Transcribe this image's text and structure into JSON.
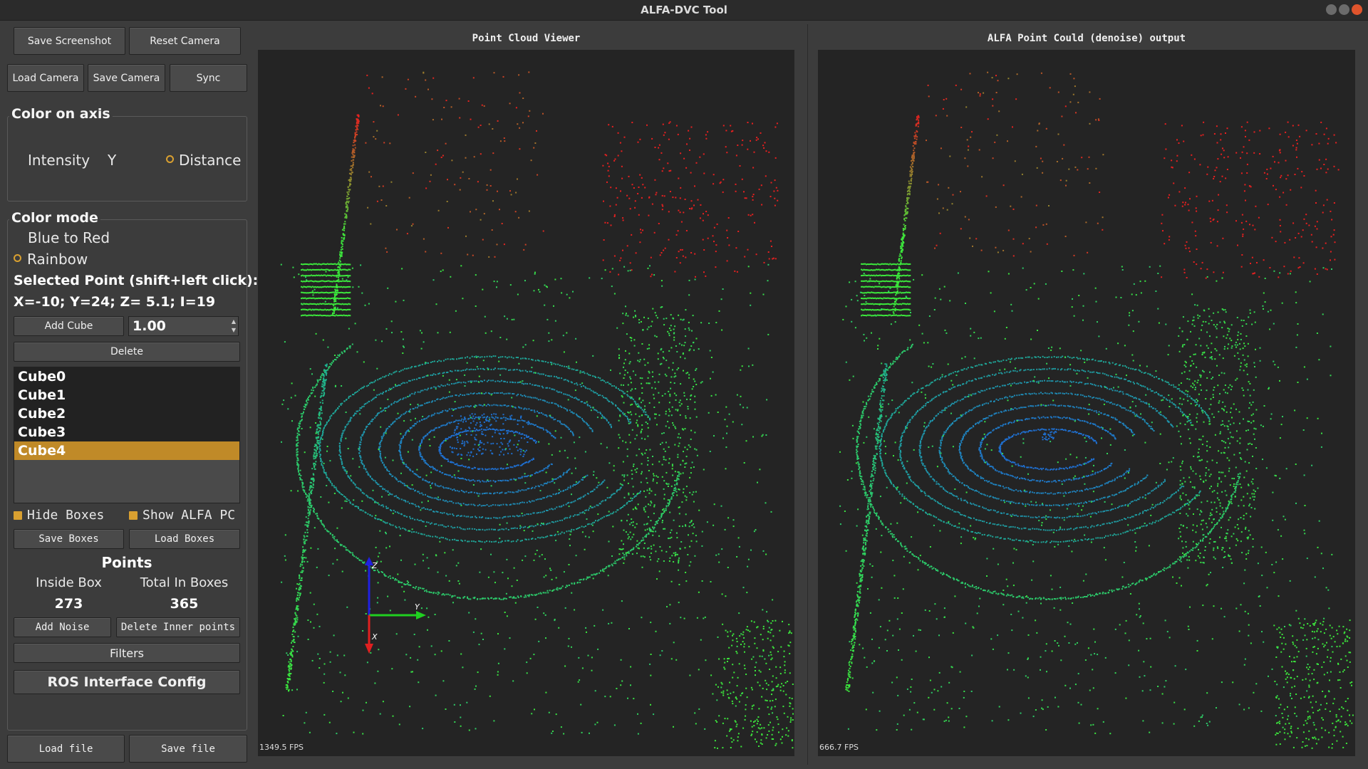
{
  "window": {
    "title": "ALFA-DVC Tool"
  },
  "camera_buttons": {
    "save_screenshot": "Save Screenshot",
    "reset_camera": "Reset Camera",
    "load_camera": "Load Camera",
    "save_camera": "Save Camera",
    "sync": "Sync"
  },
  "color_on_axis": {
    "label": "Color on axis",
    "intensity": "Intensity",
    "y": "Y",
    "distance": "Distance"
  },
  "color_mode": {
    "label": "Color mode",
    "blue_to_red": "Blue to Red",
    "rainbow": "Rainbow"
  },
  "selected_point": {
    "label": "Selected Point (shift+left click):",
    "value": "X=-10; Y=24; Z= 5.1; I=19"
  },
  "cube_controls": {
    "add_cube": "Add Cube",
    "size_value": "1.00",
    "delete": "Delete",
    "items": [
      "Cube0",
      "Cube1",
      "Cube2",
      "Cube3",
      "Cube4"
    ],
    "selected_index": 4
  },
  "box_options": {
    "hide_boxes": "Hide Boxes",
    "show_alfa_pc": "Show ALFA PC",
    "save_boxes": "Save Boxes",
    "load_boxes": "Load Boxes"
  },
  "points": {
    "label": "Points",
    "inside_box_label": "Inside Box",
    "total_in_boxes_label": "Total In Boxes",
    "inside_box_value": "273",
    "total_in_boxes_value": "365"
  },
  "actions": {
    "add_noise": "Add Noise",
    "delete_inner_points": "Delete Inner points",
    "filters": "Filters",
    "ros_interface_config": "ROS Interface Config",
    "load_file": "Load file",
    "save_file": "Save file"
  },
  "viewer_left": {
    "title": "Point Cloud Viewer",
    "fps": "1349.5 FPS"
  },
  "viewer_right": {
    "title": "ALFA Point Could (denoise) output",
    "fps": "666.7 FPS"
  },
  "axes": {
    "z": "Z",
    "y": "Y",
    "x": "X"
  },
  "colors": {
    "accent": "#d9a030",
    "selection": "#c08a28",
    "viewer_bg": "#242424",
    "near": "#1f6fd0",
    "mid": "#1fb090",
    "far_green": "#3ce83c",
    "far_red": "#e82020"
  }
}
